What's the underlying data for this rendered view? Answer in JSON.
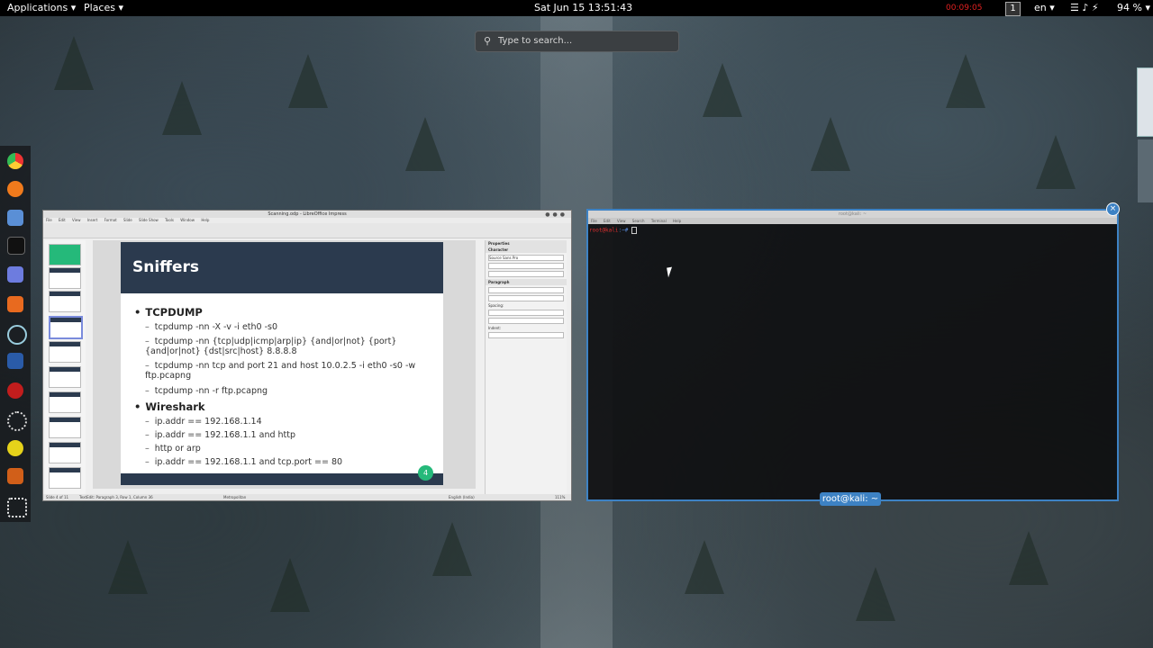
{
  "topbar": {
    "applications": "Applications ▾",
    "places": "Places ▾",
    "clock": "Sat Jun 15  13:51:43",
    "recording": "00:09:05",
    "workspace": "1",
    "language": "en ▾",
    "status_icons": "☰ ♪ ⚡",
    "battery": "94 % ▾"
  },
  "search": {
    "placeholder": "Type to search..."
  },
  "impress": {
    "title": "Scanning.odp - LibreOffice Impress",
    "menu": [
      "File",
      "Edit",
      "View",
      "Insert",
      "Format",
      "Slide",
      "Slide Show",
      "Tools",
      "Window",
      "Help"
    ],
    "slide": {
      "title": "Sniffers",
      "number": "4",
      "items": [
        {
          "level": 1,
          "text": "TCPDUMP"
        },
        {
          "level": 2,
          "text": "tcpdump -nn -X -v -i eth0 -s0"
        },
        {
          "level": 2,
          "text": "tcpdump -nn {tcp|udp|icmp|arp|ip} {and|or|not} {port} {and|or|not} {dst|src|host} 8.8.8.8"
        },
        {
          "level": 2,
          "text": "tcpdump -nn tcp and port 21 and host 10.0.2.5 -i eth0 -s0 -w ftp.pcapng"
        },
        {
          "level": 2,
          "text": "tcpdump -nn -r ftp.pcapng"
        },
        {
          "level": 1,
          "text": "Wireshark"
        },
        {
          "level": 2,
          "text": "ip.addr == 192.168.1.14"
        },
        {
          "level": 2,
          "text": "ip.addr == 192.168.1.1 and http"
        },
        {
          "level": 2,
          "text": "http or arp"
        },
        {
          "level": 2,
          "text": "ip.addr == 192.168.1.1 and tcp.port == 80"
        }
      ]
    },
    "sidebar": {
      "properties": "Properties",
      "character": "Character",
      "font": "Source Sans Pro",
      "paragraph": "Paragraph",
      "spacing": "Spacing:",
      "indent": "Indent:"
    },
    "status": {
      "slide": "Slide 4 of 11",
      "text": "TextEdit: Paragraph 3, Row 1, Column 36",
      "layout": "Metropolitan",
      "lang": "English (India)",
      "zoom": "111%"
    }
  },
  "terminal": {
    "title": "root@kali: ~",
    "menu": [
      "File",
      "Edit",
      "View",
      "Search",
      "Terminal",
      "Help"
    ],
    "prompt_user": "root@kali",
    "prompt_path": ":~#",
    "label": "root@kali: ~",
    "close": "×"
  },
  "dock": {
    "icons": [
      "chrome-icon",
      "firefox-icon",
      "files-icon",
      "terminal-icon",
      "notes-icon",
      "burp-icon",
      "eye-icon",
      "metasploit-icon",
      "cherry-icon",
      "wifi-tool-icon",
      "tool-icon",
      "impress-icon",
      "show-apps-icon"
    ]
  },
  "colors": {
    "accent": "#3d82c4",
    "slide_dark": "#2b3a4e",
    "slide_number": "#25b97a"
  }
}
